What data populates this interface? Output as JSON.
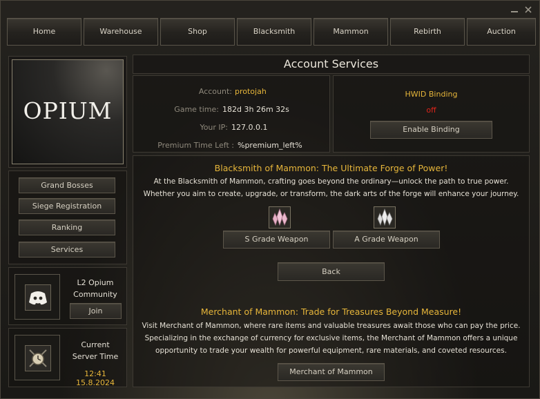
{
  "nav": [
    "Home",
    "Warehouse",
    "Shop",
    "Blacksmith",
    "Mammon",
    "Rebirth",
    "Auction"
  ],
  "logo_text": "OPIUM",
  "side_menu": [
    "Grand Bosses",
    "Siege Registration",
    "Ranking",
    "Services"
  ],
  "community": {
    "line1": "L2 Opium",
    "line2": "Community",
    "join": "Join"
  },
  "server_time": {
    "line1": "Current",
    "line2": "Server Time",
    "value": "12:41 15.8.2024"
  },
  "title": "Account Services",
  "account": {
    "account_label": "Account:",
    "account_value": "protojah",
    "game_time_label": "Game time:",
    "game_time_value": "182d 3h 26m 32s",
    "ip_label": "Your IP:",
    "ip_value": "127.0.0.1",
    "premium_label": "Premium Time Left :",
    "premium_value": "%premium_left%"
  },
  "hwid": {
    "title": "HWID Binding",
    "status": "off",
    "button": "Enable Binding"
  },
  "blacksmith": {
    "heading": "Blacksmith of Mammon: The Ultimate Forge of Power!",
    "line1": "At the Blacksmith of Mammon, crafting goes beyond the ordinary—unlock the path to true power.",
    "line2": "Whether you aim to create, upgrade, or transform, the dark arts of the forge will enhance your journey.",
    "s_grade": "S Grade Weapon",
    "a_grade": "A Grade Weapon",
    "back": "Back"
  },
  "merchant": {
    "heading": "Merchant of Mammon: Trade for Treasures Beyond Measure!",
    "line1": "Visit Merchant of Mammon, where rare items and valuable treasures await those who can pay the price.",
    "line2": "Specializing in the exchange of currency for exclusive items, the Merchant of Mammon offers a unique",
    "line3": "opportunity to trade your wealth for powerful equipment, rare materials, and coveted resources.",
    "button": "Merchant of Mammon"
  },
  "colors": {
    "gold": "#e7b63a",
    "status_off": "#e0241b",
    "border": "#5d574b"
  },
  "icons": [
    "minimize-icon",
    "close-icon",
    "discord-icon",
    "clock-icon",
    "crystal-pink-icon",
    "crystal-white-icon"
  ]
}
